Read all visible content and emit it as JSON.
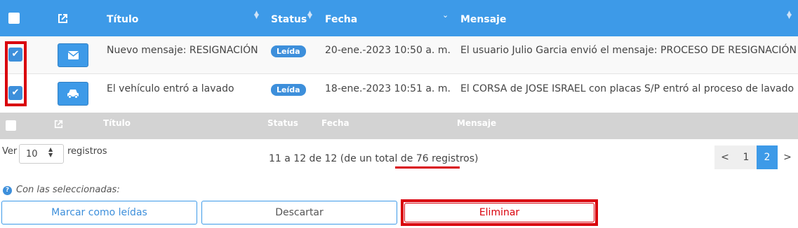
{
  "table": {
    "headers": {
      "titulo": "Título",
      "status": "Status",
      "fecha": "Fecha",
      "mensaje": "Mensaje"
    },
    "rows": [
      {
        "icon": "envelope-icon",
        "titulo": "Nuevo mensaje: RESIGNACIÓN",
        "status": "Leída",
        "fecha": "20-ene.-2023 10:50 a. m.",
        "mensaje": "El usuario Julio Garcia envió el mensaje: PROCESO DE RESIGNACIÓN",
        "checked": true
      },
      {
        "icon": "car-icon",
        "titulo": "El vehículo entró a lavado",
        "status": "Leída",
        "fecha": "18-ene.-2023 10:51 a. m.",
        "mensaje": "El CORSA de JOSE ISRAEL con placas S/P entró al proceso de lavado",
        "checked": true
      }
    ]
  },
  "length_menu": {
    "prefix": "Ver",
    "value": "10",
    "suffix": "registros"
  },
  "info": {
    "range": "11 a 12 de 12 (de un total de",
    "total": "76 registros",
    "close": ")"
  },
  "pagination": {
    "prev": "<",
    "pages": [
      "1",
      "2"
    ],
    "active_page": "2",
    "next": ">"
  },
  "bulk": {
    "label": "Con las seleccionadas:",
    "mark_read": "Marcar como leídas",
    "discard": "Descartar",
    "delete": "Eliminar"
  },
  "colors": {
    "header_bg": "#3d9ae8",
    "footer_bg": "#d3d3d3",
    "badge_bg": "#3d8fdb",
    "highlight": "#d9000b"
  }
}
